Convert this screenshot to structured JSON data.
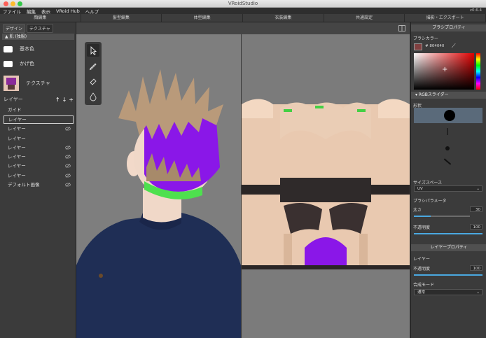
{
  "window": {
    "title": "VRoidStudio",
    "version": "v0.6.4"
  },
  "menu": [
    "ファイル",
    "編集",
    "表示",
    "VRoid Hub",
    "ヘルプ"
  ],
  "tabs": [
    "顔編集",
    "髪型編集",
    "体型編集",
    "衣装編集",
    "共通設定",
    "撮影・エクスポート"
  ],
  "left_panel": {
    "subtabs": [
      "デザイン",
      "テクスチャ"
    ],
    "section_title": "肌 (独服)",
    "base_color_label": "基本色",
    "shadow_color_label": "かげ色",
    "texture_label": "テクスチャ",
    "layer_label": "レイヤー",
    "layers": [
      {
        "label": "ガイド",
        "selected": false,
        "hidden": false
      },
      {
        "label": "レイヤー",
        "selected": true,
        "hidden": false
      },
      {
        "label": "レイヤー",
        "selected": false,
        "hidden": true
      },
      {
        "label": "レイヤー",
        "selected": false,
        "hidden": false
      },
      {
        "label": "レイヤー",
        "selected": false,
        "hidden": true
      },
      {
        "label": "レイヤー",
        "selected": false,
        "hidden": true
      },
      {
        "label": "レイヤー",
        "selected": false,
        "hidden": true
      },
      {
        "label": "レイヤー",
        "selected": false,
        "hidden": true
      },
      {
        "label": "デフォルト画像",
        "selected": false,
        "hidden": true
      }
    ]
  },
  "tools": [
    "select-arrow-icon",
    "pen-icon",
    "eraser-icon",
    "fill-icon"
  ],
  "right_panel": {
    "brush_props_title": "ブラシプロパティ",
    "brush_color_label": "ブラシカラー",
    "brush_color_hex": "# 804040",
    "brush_color": "#804040",
    "rgb_slider_label": "RGBスライダー",
    "shape_label": "形状",
    "size_space_label": "サイズスペース",
    "size_space_value": "UV",
    "brush_params_label": "ブラシパラメータ",
    "thickness_label": "太さ",
    "thickness_value": "30",
    "thickness_fraction": 0.3,
    "opacity_label": "不透明度",
    "opacity_value": "100",
    "opacity_fraction": 1.0,
    "layer_props_title": "レイヤープロパティ",
    "layer_label": "レイヤー",
    "layer_opacity_label": "不透明度",
    "layer_opacity_value": "100",
    "layer_opacity_fraction": 1.0,
    "blend_mode_label": "合成モード",
    "blend_mode_value": "通常"
  }
}
